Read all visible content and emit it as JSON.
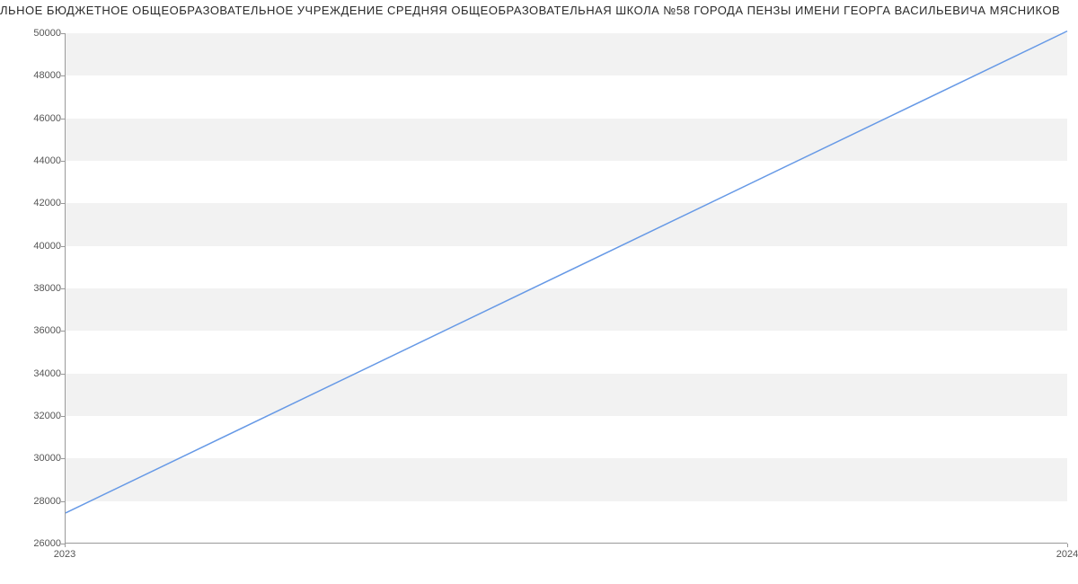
{
  "chart_data": {
    "type": "line",
    "title": "ЛЬНОЕ БЮДЖЕТНОЕ ОБЩЕОБРАЗОВАТЕЛЬНОЕ УЧРЕЖДЕНИЕ СРЕДНЯЯ ОБЩЕОБРАЗОВАТЕЛЬНАЯ ШКОЛА №58 ГОРОДА ПЕНЗЫ ИМЕНИ ГЕОРГА ВАСИЛЬЕВИЧА МЯСНИКОВ",
    "xlabel": "",
    "ylabel": "",
    "x": [
      2023,
      2024
    ],
    "values": [
      27400,
      50100
    ],
    "xlim": [
      2023,
      2024
    ],
    "ylim": [
      26000,
      50000
    ],
    "y_ticks": [
      26000,
      28000,
      30000,
      32000,
      34000,
      36000,
      38000,
      40000,
      42000,
      44000,
      46000,
      48000,
      50000
    ],
    "x_ticks": [
      2023,
      2024
    ],
    "line_color": "#6699e6",
    "grid_band_color": "#f2f2f2"
  }
}
